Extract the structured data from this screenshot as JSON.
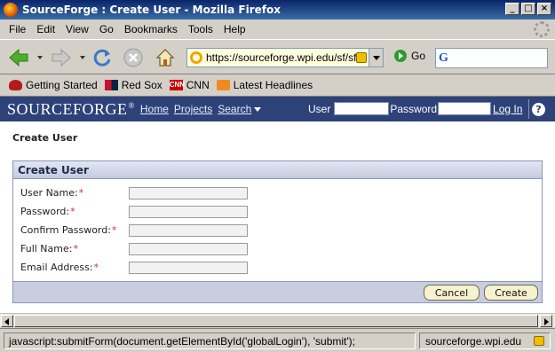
{
  "window": {
    "title": "SourceForge : Create User - Mozilla Firefox"
  },
  "menubar": {
    "items": [
      {
        "label": "File"
      },
      {
        "label": "Edit"
      },
      {
        "label": "View"
      },
      {
        "label": "Go"
      },
      {
        "label": "Bookmarks"
      },
      {
        "label": "Tools"
      },
      {
        "label": "Help"
      }
    ]
  },
  "navbar": {
    "url": "https://sourceforge.wpi.edu/sf/sf",
    "go_label": "Go",
    "search_value": ""
  },
  "bookmarks": [
    {
      "label": "Getting Started",
      "icon": "getting-started-icon"
    },
    {
      "label": "Red Sox",
      "icon": "red-sox-icon"
    },
    {
      "label": "CNN",
      "icon": "cnn-icon",
      "icon_text": "CNN"
    },
    {
      "label": "Latest Headlines",
      "icon": "rss-icon"
    }
  ],
  "sf_header": {
    "logo": "SOURCEFORGE",
    "logo_reg": "®",
    "nav": {
      "home": "Home",
      "projects": "Projects",
      "search": "Search"
    },
    "user_label": "User",
    "password_label": "Password",
    "login_link": "Log In",
    "help": "?"
  },
  "page": {
    "title": "Create User",
    "panel_title": "Create User",
    "fields": [
      {
        "label": "User Name:",
        "required": "*",
        "value": ""
      },
      {
        "label": "Password:",
        "required": "*",
        "value": ""
      },
      {
        "label": "Confirm Password:",
        "required": "*",
        "value": ""
      },
      {
        "label": "Full Name:",
        "required": "*",
        "value": ""
      },
      {
        "label": "Email Address:",
        "required": "*",
        "value": ""
      }
    ],
    "cancel_label": "Cancel",
    "create_label": "Create"
  },
  "status": {
    "message": "javascript:submitForm(document.getElementById('globalLogin'), 'submit');",
    "site": "sourceforge.wpi.edu"
  },
  "colors": {
    "title_bar": "#0a246a",
    "sf_header": "#2c4279",
    "panel_header": "#c4cbe0",
    "button_bg": "#f6f1cf",
    "required": "#c0392b"
  }
}
